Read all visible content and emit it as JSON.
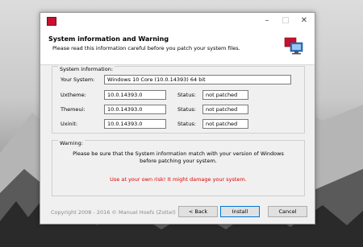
{
  "window": {
    "title_placeholder": ""
  },
  "header": {
    "title": "System information and Warning",
    "subtitle": "Please read this information careful before you patch your system files."
  },
  "sysinfo": {
    "group_label": "System information:",
    "your_system_label": "Your System:",
    "your_system_value": "Windows 10 Core (10.0.14393) 64 bit",
    "rows": [
      {
        "label": "Uxtheme:",
        "value": "10.0.14393.0",
        "status_label": "Status:",
        "status_value": "not patched"
      },
      {
        "label": "Themeui:",
        "value": "10.0.14393.0",
        "status_label": "Status:",
        "status_value": "not patched"
      },
      {
        "label": "Uxinit:",
        "value": "10.0.14393.0",
        "status_label": "Status:",
        "status_value": "not patched"
      }
    ]
  },
  "warning": {
    "group_label": "Warning:",
    "line1": "Please be sure that the System information match with your version of Windows",
    "line2": "before patching your system.",
    "risk": "Use at your own risk! It might damage your system."
  },
  "footer": {
    "copyright": "Copyright 2008 - 2016 © Manuel Hoefs (Zottel)",
    "back_label": "< Back",
    "install_label": "Install",
    "cancel_label": "Cancel"
  },
  "icons": {
    "minimize": "minimize-icon",
    "maximize": "maximize-icon",
    "close": "close-icon",
    "app": "app-icon",
    "logo": "patcher-logo-icon"
  },
  "colors": {
    "risk_text": "#e00000",
    "primary_border": "#0078d7"
  }
}
